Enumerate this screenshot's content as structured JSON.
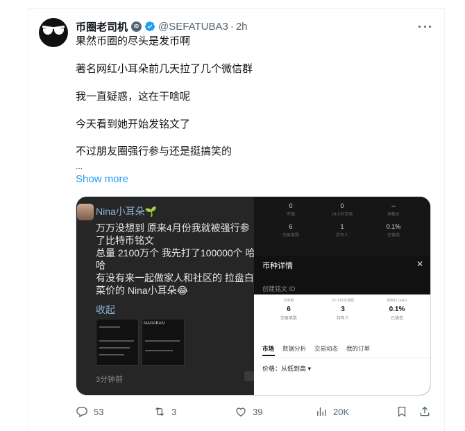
{
  "tweet": {
    "display_name": "币圈老司机",
    "id_badge": "ID",
    "handle": "@SEFATUBA3",
    "separator": "·",
    "time": "2h",
    "lines": [
      "果然币圈的尽头是发币啊",
      "著名网红小耳朵前几天拉了几个微信群",
      "我一直疑惑，这在干啥呢",
      "今天看到她开始发铭文了",
      "不过朋友圈强行参与还是挺搞笑的",
      "..."
    ],
    "show_more": "Show more"
  },
  "media": {
    "left": {
      "name": "Nina小耳朵🌱",
      "lines": [
        "万万没想到 原来4月份我就被强行参",
        "了比特币铭文",
        "总量 2100万个 我先打了100000个 哈",
        "哈",
        "有没有来一起做家人和社区的  拉盘白",
        "菜价的 Nina小耳朵😂"
      ],
      "collapse": "收起",
      "thumb_caption": "MAGABAN",
      "time": "3分钟前"
    },
    "right": {
      "top_stats": [
        {
          "value": "0",
          "label": "市值"
        },
        {
          "value": "0",
          "label": "24小时交易"
        },
        {
          "value": "--",
          "label": "地板价"
        },
        {
          "value": "6",
          "label": "交易笔数"
        },
        {
          "value": "1",
          "label": "持有人"
        },
        {
          "value": "0.1%",
          "label": "已铸造"
        }
      ],
      "drawer_title": "币种详情",
      "drawer_close": "✕",
      "drawer_sub": "创建铭文 ID",
      "stats": [
        {
          "head": "交易额",
          "value": "6",
          "label": "交易笔数"
        },
        {
          "head": "24 小时交易额",
          "value": "3",
          "label": "持有人"
        },
        {
          "head": "地板价 (sats)",
          "value": "0.1%",
          "label": "已铸造"
        }
      ],
      "tabs": [
        "市场",
        "数据分析",
        "交易动态",
        "我的订单"
      ],
      "sort_label": "价格：",
      "sort_value": "从低到高 ▾"
    }
  },
  "actions": {
    "replies": "53",
    "reposts": "3",
    "likes": "39",
    "views": "20K"
  },
  "colors": {
    "accent": "#1d9bf0",
    "muted": "#536471",
    "text": "#0f1419"
  }
}
